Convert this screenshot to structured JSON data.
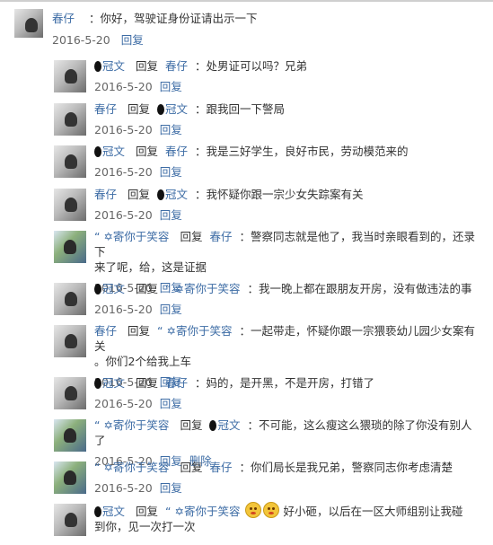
{
  "post": {
    "author": "春仔",
    "text": "：你好，驾驶证身份证请出示一下",
    "date": "2016-5-20",
    "reply_label": "回复"
  },
  "replies": [
    {
      "avatar": "av-a",
      "from": "冠文",
      "from_blot": true,
      "to": "春仔",
      "to_blot": false,
      "lines": [
        "：处男证可以吗？兄弟"
      ],
      "date": "2016-5-20",
      "actions": [
        "回复"
      ]
    },
    {
      "avatar": "av-a",
      "from": "春仔",
      "from_blot": false,
      "to": "冠文",
      "to_blot": true,
      "lines": [
        "：跟我回一下警局"
      ],
      "date": "2016-5-20",
      "actions": [
        "回复"
      ]
    },
    {
      "avatar": "av-a",
      "from": "冠文",
      "from_blot": true,
      "to": "春仔",
      "to_blot": false,
      "lines": [
        "：我是三好学生，良好市民，劳动模范来的"
      ],
      "date": "2016-5-20",
      "actions": [
        "回复"
      ]
    },
    {
      "avatar": "av-a",
      "from": "春仔",
      "from_blot": false,
      "to": "冠文",
      "to_blot": true,
      "lines": [
        "：我怀疑你跟一宗少女失踪案有关"
      ],
      "date": "2016-5-20",
      "actions": [
        "回复"
      ]
    },
    {
      "avatar": "av-b",
      "from": "“ ✡寄你于笑容",
      "from_blot": false,
      "to": "春仔",
      "to_blot": false,
      "lines": [
        "：警察同志就是他了，我当时亲眼看到的，还录下",
        "来了呢，给，这是证据"
      ],
      "date": "2016-5-20",
      "actions": [
        "回复"
      ]
    },
    {
      "avatar": "av-a",
      "from": "冠文",
      "from_blot": true,
      "to": "“ ✡寄你于笑容",
      "to_blot": false,
      "lines": [
        "：我一晚上都在跟朋友开房，没有做违法的事"
      ],
      "date": "2016-5-20",
      "actions": [
        "回复"
      ]
    },
    {
      "avatar": "av-a",
      "from": "春仔",
      "from_blot": false,
      "to": "“ ✡寄你于笑容",
      "to_blot": false,
      "lines": [
        "：一起带走，怀疑你跟一宗猥亵幼儿园少女案有关",
        "。你们2个给我上车"
      ],
      "date": "2016-5-20",
      "actions": [
        "回复"
      ]
    },
    {
      "avatar": "av-a",
      "from": "冠文",
      "from_blot": true,
      "to": "春仔",
      "to_blot": false,
      "lines": [
        "：妈的，是开黑，不是开房，打错了"
      ],
      "date": "2016-5-20",
      "actions": [
        "回复"
      ]
    },
    {
      "avatar": "av-b",
      "from": "“ ✡寄你于笑容",
      "from_blot": false,
      "to": "冠文",
      "to_blot": true,
      "lines": [
        "：不可能，这么瘦这么猥琐的除了你没有别人了"
      ],
      "date": "2016-5-20",
      "actions": [
        "回复",
        "删除"
      ]
    },
    {
      "avatar": "av-b",
      "from": "“ ✡寄你于笑容",
      "from_blot": false,
      "to": "春仔",
      "to_blot": false,
      "lines": [
        "：你们局长是我兄弟，警察同志你考虑清楚"
      ],
      "date": "2016-5-20",
      "actions": [
        "回复"
      ]
    },
    {
      "avatar": "av-a",
      "from": "冠文",
      "from_blot": true,
      "to": "“ ✡寄你于笑容",
      "to_blot": false,
      "emoji_count": 2,
      "lines": [
        "好小砸，以后在一区大师组别让我碰",
        "到你，见一次打一次"
      ],
      "date": "",
      "actions": []
    }
  ],
  "labels": {
    "reply_word": "回复"
  }
}
